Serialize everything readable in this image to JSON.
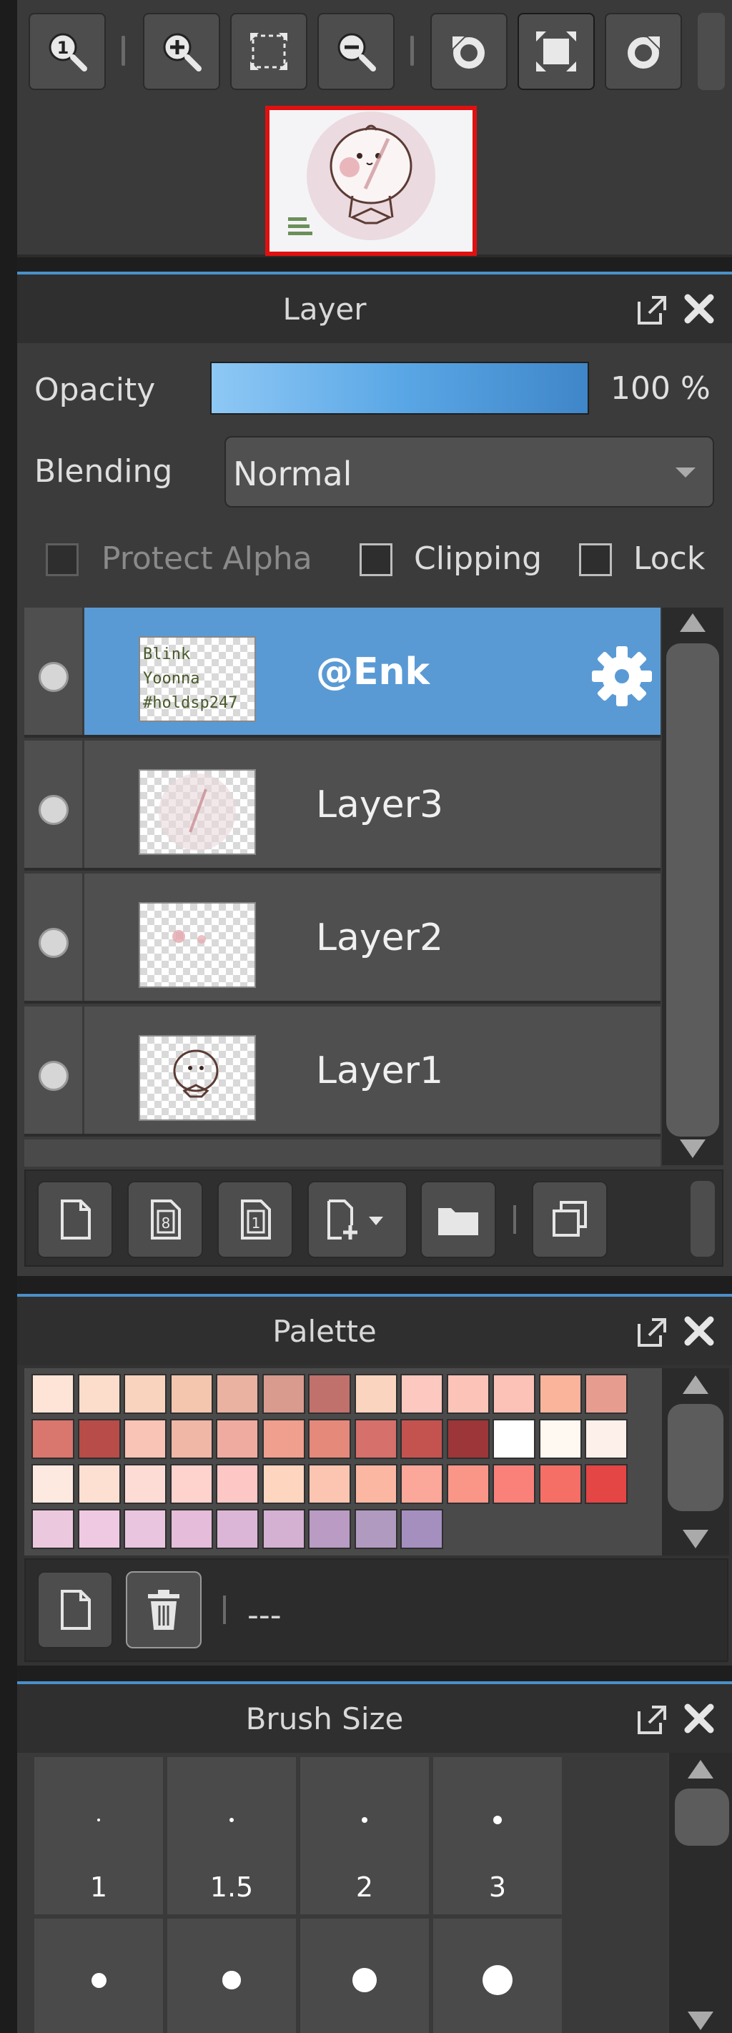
{
  "navigator": {
    "toolbar": [
      {
        "name": "zoom-actual-size-icon",
        "title": "Actual size"
      },
      {
        "name": "zoom-in-icon",
        "title": "Zoom in"
      },
      {
        "name": "fit-screen-icon",
        "title": "Fit"
      },
      {
        "name": "zoom-out-icon",
        "title": "Zoom out"
      },
      {
        "name": "rotate-left-icon",
        "title": "Rotate left"
      },
      {
        "name": "full-screen-icon",
        "title": "Full screen"
      },
      {
        "name": "rotate-right-icon",
        "title": "Rotate right"
      }
    ]
  },
  "layer_panel": {
    "title": "Layer",
    "opacity_label": "Opacity",
    "opacity_value": "100 %",
    "opacity_fraction": 1.0,
    "blending_label": "Blending",
    "blending_value": "Normal",
    "protect_alpha": {
      "label": "Protect Alpha",
      "checked": false,
      "enabled": false
    },
    "clipping": {
      "label": "Clipping",
      "checked": false
    },
    "lock": {
      "label": "Lock",
      "checked": false
    },
    "layers": [
      {
        "name": "@Enk",
        "active": true,
        "visible": true
      },
      {
        "name": "Layer3",
        "active": false,
        "visible": true
      },
      {
        "name": "Layer2",
        "active": false,
        "visible": true
      },
      {
        "name": "Layer1",
        "active": false,
        "visible": true
      }
    ],
    "thumbnail_text": [
      "Blink",
      "Yoonna",
      "#holdsp247"
    ],
    "buttons": [
      {
        "name": "new-layer-icon"
      },
      {
        "name": "new-8bit-layer-icon"
      },
      {
        "name": "new-1bit-layer-icon"
      },
      {
        "name": "add-layer-menu-icon"
      },
      {
        "name": "folder-icon"
      },
      {
        "name": "duplicate-layer-icon"
      }
    ]
  },
  "palette_panel": {
    "title": "Palette",
    "name": "---",
    "colors": [
      "#fde4d6",
      "#fcdccb",
      "#f9d3bd",
      "#f4c6ad",
      "#e9b2a1",
      "#d99b8d",
      "#c0716c",
      "#fbd4c0",
      "#fcc8bf",
      "#fcc4b9",
      "#fcc2b8",
      "#f9b49b",
      "#e69d90",
      "#d9766d",
      "#b84c48",
      "#f9c3b6",
      "#f0b6a6",
      "#f0aba0",
      "#f09e8d",
      "#e5897b",
      "#d6706a",
      "#c4534f",
      "#9c3638",
      "#ffffff",
      "#fff9f2",
      "#fdf0ea",
      "#fde9df",
      "#fee0d2",
      "#fedcd6",
      "#fed2cd",
      "#fcc7c4",
      "#fed6c0",
      "#fcc5b1",
      "#fcb7a2",
      "#fba79a",
      "#f99688",
      "#f9817a",
      "#f56f66",
      "#e44545",
      "#ecc8df",
      "#efc9e1",
      "#e9c5df",
      "#e5bcd9",
      "#dcb6d6",
      "#d4b0d2",
      "#b99bc4",
      "#b19ac0",
      "#a58fbf"
    ],
    "buttons": [
      {
        "name": "new-palette-icon"
      },
      {
        "name": "delete-palette-icon"
      }
    ]
  },
  "brush_size_panel": {
    "title": "Brush Size",
    "sizes": [
      "1",
      "1.5",
      "2",
      "3"
    ],
    "dot_sizes": [
      1,
      1.5,
      2,
      3,
      5,
      6,
      8,
      10
    ]
  }
}
